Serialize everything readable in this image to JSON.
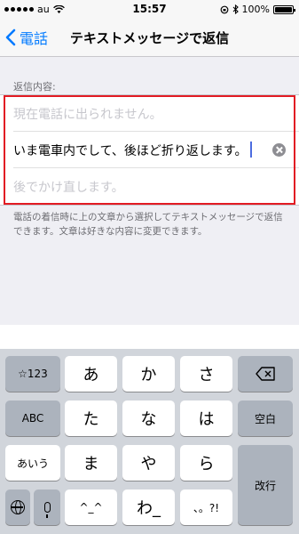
{
  "status_bar": {
    "carrier": "au",
    "time": "15:57",
    "battery": "100%"
  },
  "nav": {
    "back_label": "電話",
    "title": "テキストメッセージで返信"
  },
  "section": {
    "header": "返信内容:"
  },
  "responses": [
    {
      "text": "現在電話に出られません。",
      "is_placeholder": true
    },
    {
      "text": "いま電車内でして、後ほど折り返します。",
      "is_placeholder": false
    },
    {
      "text": "後でかけ直します。",
      "is_placeholder": true
    }
  ],
  "footer_note": "電話の着信時に上の文章から選択してテキストメッセージで返信できます。文章は好きな内容に変更できます。",
  "keyboard": {
    "row1": [
      "☆123",
      "あ",
      "か",
      "さ"
    ],
    "row2": [
      "ABC",
      "た",
      "な",
      "は",
      "空白"
    ],
    "row3": [
      "あいう",
      "ま",
      "や",
      "ら"
    ],
    "row4": [
      "^_^",
      "わ_",
      "、。?!"
    ],
    "return_label": "改行",
    "icons": [
      "delete-icon",
      "globe-icon",
      "microphone-icon"
    ]
  },
  "colors": {
    "accent": "#007aff",
    "highlight": "#e21b23",
    "cursor": "#4c6ce0"
  }
}
